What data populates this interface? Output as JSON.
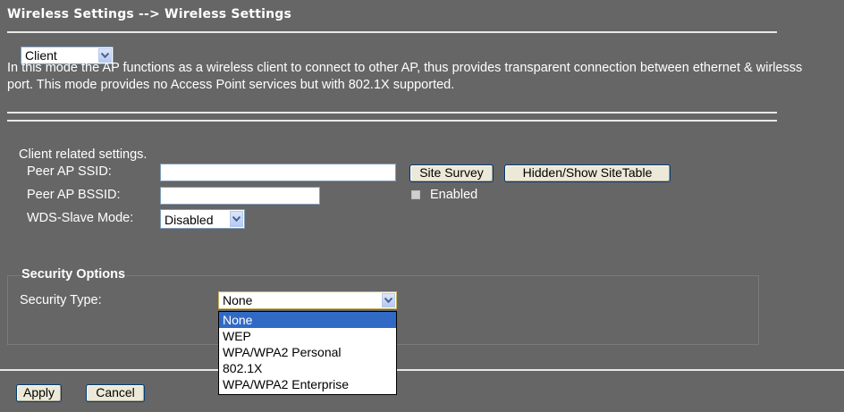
{
  "header": {
    "title": "Wireless Settings --> Wireless Settings"
  },
  "mode": {
    "selected": "Client",
    "description": "In this mode the AP functions as a wireless client to connect to other AP, thus provides transparent connection between ethernet & wirlesss port. This mode provides no Access Point services but with 802.1X supported."
  },
  "client": {
    "section_label": "Client related settings.",
    "peer_ssid_label": "Peer AP SSID:",
    "peer_ssid_value": "",
    "peer_bssid_label": "Peer AP BSSID:",
    "peer_bssid_value": "",
    "site_survey_label": "Site Survey",
    "hidden_show_label": "Hidden/Show SiteTable",
    "enabled_label": "Enabled",
    "enabled_checked": false,
    "wds_label": "WDS-Slave Mode:",
    "wds_value": "Disabled"
  },
  "security": {
    "legend": "Security Options",
    "type_label": "Security Type:",
    "type_value": "None",
    "options": [
      "None",
      "WEP",
      "WPA/WPA2 Personal",
      "802.1X",
      "WPA/WPA2 Enterprise"
    ],
    "highlighted_index": 0
  },
  "footer": {
    "apply_label": "Apply",
    "cancel_label": "Cancel"
  }
}
